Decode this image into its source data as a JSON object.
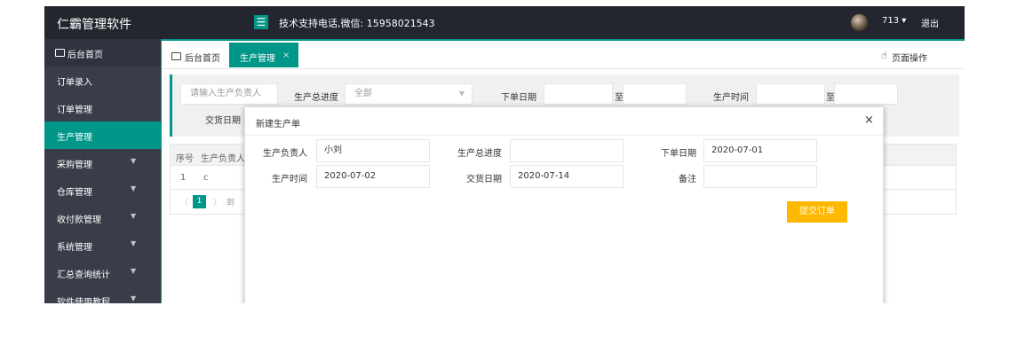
{
  "header": {
    "app_title": "仁霸管理软件",
    "menu_icon": "hamburger-icon",
    "support_text": "技术支持电话,微信: 15958021543",
    "user_name": "713 ▾",
    "logout_label": "退出"
  },
  "sidebar": {
    "home_label": "后台首页",
    "items": [
      {
        "label": "订单录入",
        "has_arrow": false
      },
      {
        "label": "订单管理",
        "has_arrow": false
      },
      {
        "label": "生产管理",
        "has_arrow": false,
        "active": true
      },
      {
        "label": "采购管理",
        "has_arrow": true
      },
      {
        "label": "仓库管理",
        "has_arrow": true
      },
      {
        "label": "收付款管理",
        "has_arrow": true
      },
      {
        "label": "系统管理",
        "has_arrow": true
      },
      {
        "label": "汇总查询统计",
        "has_arrow": true
      },
      {
        "label": "软件使用教程",
        "has_arrow": true
      }
    ],
    "arrow_glyph": "▼"
  },
  "tabs": {
    "home_label": "后台首页",
    "active_label": "生产管理",
    "close_glyph": "×",
    "page_op_label": "页面操作"
  },
  "filter": {
    "owner_placeholder": "请输入生产负责人",
    "progress_label": "生产总进度",
    "progress_value": "全部",
    "order_date_label": "下单日期",
    "to_label": "至",
    "production_time_label": "生产时间",
    "to_label2": "至",
    "delivery_date_label": "交货日期"
  },
  "table": {
    "headers": [
      "序号",
      "生产负责人"
    ],
    "rows": [
      [
        "1",
        "c"
      ]
    ],
    "pager": {
      "prev": "〈",
      "current": "1",
      "next": "〉",
      "goto": "到"
    }
  },
  "modal": {
    "title": "新建生产单",
    "close_glyph": "×",
    "fields": {
      "owner_label": "生产负责人",
      "owner_value": "小刘",
      "progress_label": "生产总进度",
      "progress_value": "",
      "order_date_label": "下单日期",
      "order_date_value": "2020-07-01",
      "production_time_label": "生产时间",
      "production_time_value": "2020-07-02",
      "delivery_date_label": "交货日期",
      "delivery_date_value": "2020-07-14",
      "note_label": "备注",
      "note_value": ""
    },
    "submit_label": "提交订单"
  },
  "colors": {
    "teal": "#009688",
    "sidebar_bg": "#393d49",
    "header_bg": "#23262e",
    "submit_bg": "#ffb800"
  }
}
